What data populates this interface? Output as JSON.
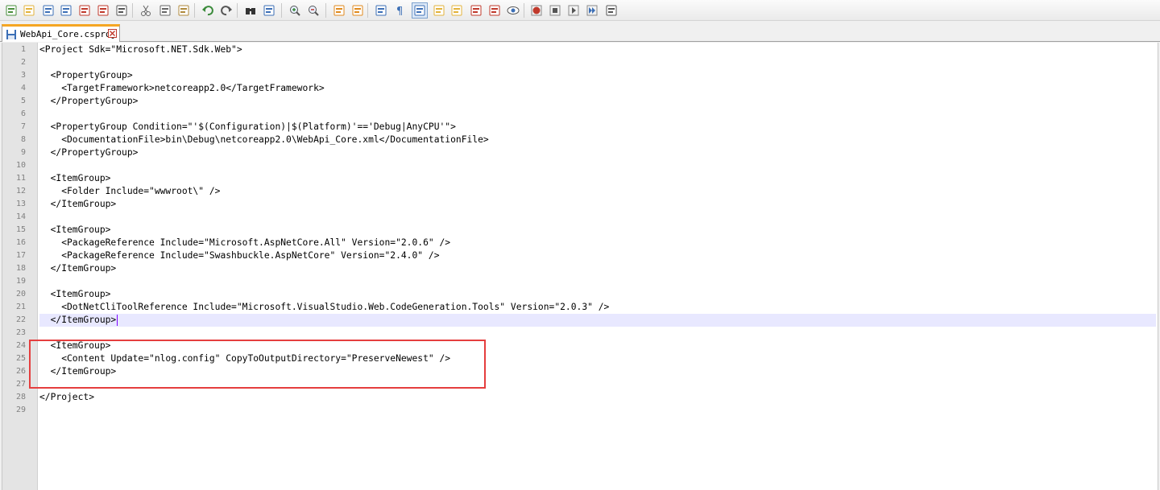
{
  "toolbar": {
    "buttons": [
      {
        "icon": "new-file-icon",
        "color": "#4a8f3c"
      },
      {
        "icon": "open-folder-icon",
        "color": "#e3b33b"
      },
      {
        "icon": "save-icon",
        "color": "#3c6fb6"
      },
      {
        "icon": "save-all-icon",
        "color": "#3c6fb6"
      },
      {
        "icon": "close-file-icon",
        "color": "#c0392b"
      },
      {
        "icon": "close-all-icon",
        "color": "#c0392b"
      },
      {
        "icon": "print-icon",
        "color": "#555555"
      },
      {
        "icon": "cut-icon",
        "color": "#666666"
      },
      {
        "icon": "copy-icon",
        "color": "#666666"
      },
      {
        "icon": "paste-icon",
        "color": "#b08a3c"
      },
      {
        "icon": "undo-icon",
        "color": "#3a8a3a"
      },
      {
        "icon": "redo-icon",
        "color": "#555555"
      },
      {
        "icon": "find-icon",
        "color": "#333333"
      },
      {
        "icon": "replace-icon",
        "color": "#3c6fb6"
      },
      {
        "icon": "zoom-in-icon",
        "color": "#3a8a3a"
      },
      {
        "icon": "zoom-out-icon",
        "color": "#c0392b"
      },
      {
        "icon": "sync-vertical-icon",
        "color": "#e08a1e"
      },
      {
        "icon": "sync-horizontal-icon",
        "color": "#e08a1e"
      },
      {
        "icon": "word-wrap-icon",
        "color": "#3c6fb6"
      },
      {
        "icon": "show-all-chars-icon",
        "color": "#3c6fb6"
      },
      {
        "icon": "indent-guide-icon",
        "color": "#3c6fb6"
      },
      {
        "icon": "user-language-icon",
        "color": "#e3b33b"
      },
      {
        "icon": "doc-map-icon",
        "color": "#e3b33b"
      },
      {
        "icon": "function-list-icon",
        "color": "#c0392b"
      },
      {
        "icon": "folder-workspace-icon",
        "color": "#c0392b"
      },
      {
        "icon": "monitoring-icon",
        "color": "#3c6fb6"
      },
      {
        "icon": "record-macro-icon",
        "color": "#c0392b"
      },
      {
        "icon": "stop-macro-icon",
        "color": "#555555"
      },
      {
        "icon": "play-macro-icon",
        "color": "#555555"
      },
      {
        "icon": "run-macro-multiple-icon",
        "color": "#3c6fb6"
      },
      {
        "icon": "save-macro-icon",
        "color": "#555555"
      }
    ]
  },
  "tab": {
    "label": "WebApi_Core.csproj",
    "close_color": "#c0392b"
  },
  "editor": {
    "lines": [
      "<Project Sdk=\"Microsoft.NET.Sdk.Web\">",
      "",
      "  <PropertyGroup>",
      "    <TargetFramework>netcoreapp2.0</TargetFramework>",
      "  </PropertyGroup>",
      "",
      "  <PropertyGroup Condition=\"'$(Configuration)|$(Platform)'=='Debug|AnyCPU'\">",
      "    <DocumentationFile>bin\\Debug\\netcoreapp2.0\\WebApi_Core.xml</DocumentationFile>",
      "  </PropertyGroup>",
      "",
      "  <ItemGroup>",
      "    <Folder Include=\"wwwroot\\\" />",
      "  </ItemGroup>",
      "",
      "  <ItemGroup>",
      "    <PackageReference Include=\"Microsoft.AspNetCore.All\" Version=\"2.0.6\" />",
      "    <PackageReference Include=\"Swashbuckle.AspNetCore\" Version=\"2.4.0\" />",
      "  </ItemGroup>",
      "",
      "  <ItemGroup>",
      "    <DotNetCliToolReference Include=\"Microsoft.VisualStudio.Web.CodeGeneration.Tools\" Version=\"2.0.3\" />",
      "  </ItemGroup>",
      "",
      "  <ItemGroup>",
      "    <Content Update=\"nlog.config\" CopyToOutputDirectory=\"PreserveNewest\" />",
      "  </ItemGroup>",
      "",
      "</Project>",
      ""
    ],
    "current_line": 22,
    "highlight_color": "#e53e3e",
    "current_line_color": "#e8e8ff"
  }
}
